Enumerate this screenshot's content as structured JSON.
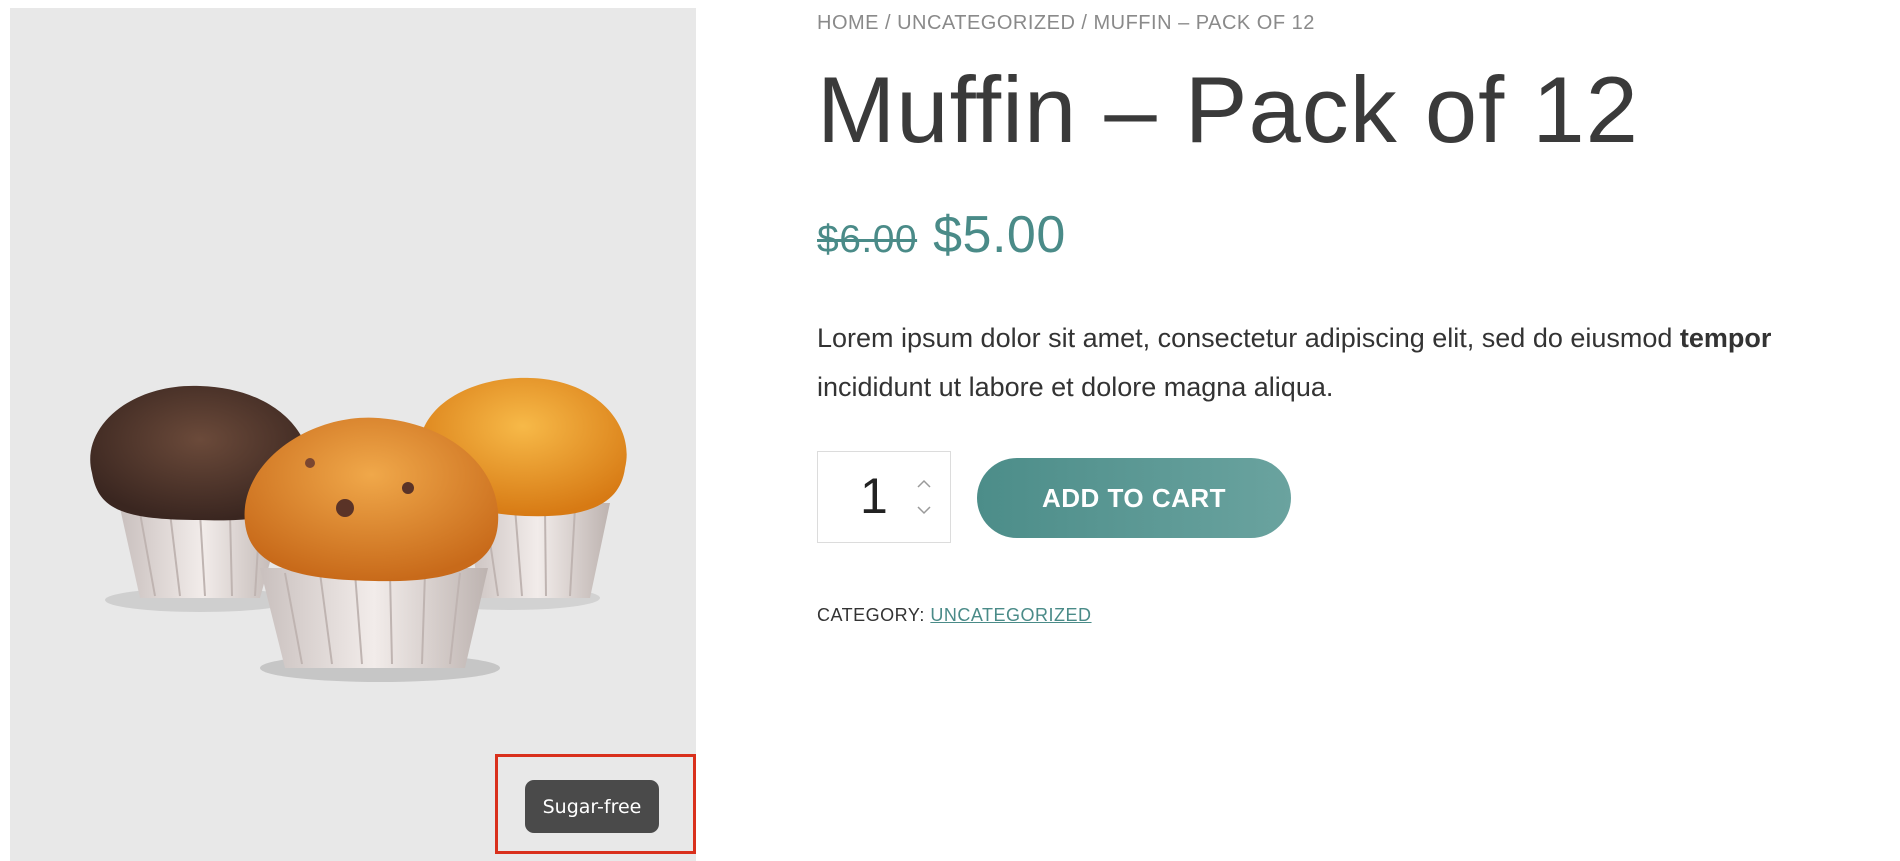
{
  "breadcrumb": {
    "items": [
      "HOME",
      "UNCATEGORIZED",
      "MUFFIN – PACK OF 12"
    ],
    "separator": "/"
  },
  "product": {
    "title": "Muffin – Pack of 12",
    "price_old": "$6.00",
    "price_new": "$5.00",
    "description_part1": "Lorem ipsum dolor sit amet, consectetur adipiscing elit, sed do eiusmod ",
    "description_bold": "tempor",
    "description_part2": "incididunt ut labore et dolore magna aliqua.",
    "quantity": "1",
    "add_to_cart_label": "ADD TO CART",
    "category_label": "CATEGORY:",
    "category_link": "UNCATEGORIZED",
    "badge_label": "Sugar-free"
  },
  "colors": {
    "accent": "#4a8b88",
    "badge_bg": "#4a4a4a",
    "highlight": "#d9301c",
    "image_bg": "#e8e8e8"
  },
  "icons": {
    "qty_up": "chevron-up-icon",
    "qty_down": "chevron-down-icon"
  }
}
